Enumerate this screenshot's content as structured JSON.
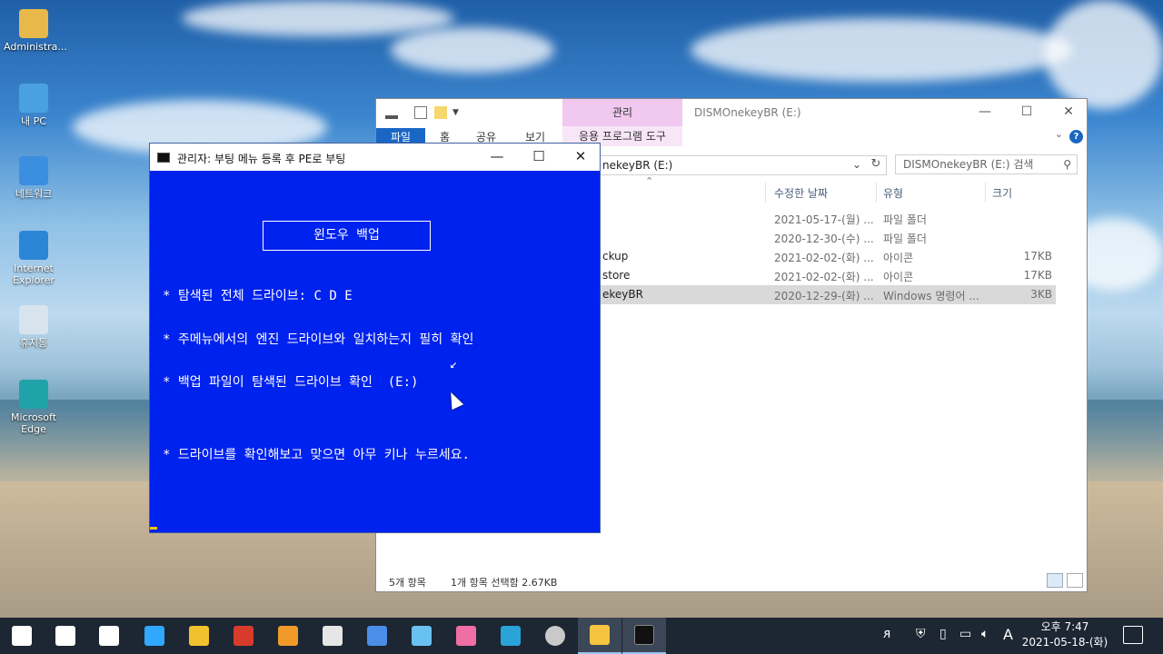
{
  "desktop": {
    "icons": [
      {
        "label": "Administra...",
        "color": "#e8b84a"
      },
      {
        "label": "내 PC",
        "color": "#4aa0e0"
      },
      {
        "label": "네트워크",
        "color": "#3c8fe0"
      },
      {
        "label": "Internet Explorer",
        "color": "#2b86d8"
      },
      {
        "label": "휴지통",
        "color": "#d7e4ee"
      },
      {
        "label": "Microsoft Edge",
        "color": "#1fa3a8"
      }
    ]
  },
  "explorer": {
    "manage_tab": "관리",
    "title": "DISMOnekeyBR (E:)",
    "ribbon_tabs": [
      "파일",
      "홈",
      "공유",
      "보기"
    ],
    "app_tools": "응용 프로그램 도구",
    "address": "nekeyBR (E:)",
    "search_placeholder": "DISMOnekeyBR (E:) 검색",
    "columns": {
      "date": "수정한 날짜",
      "type": "유형",
      "size": "크기"
    },
    "rows": [
      {
        "name": "",
        "date": "2021-05-17-(월) ...",
        "type": "파일 폴더",
        "size": ""
      },
      {
        "name": "",
        "date": "2020-12-30-(수) ...",
        "type": "파일 폴더",
        "size": ""
      },
      {
        "name": "ckup",
        "date": "2021-02-02-(화) ...",
        "type": "아이콘",
        "size": "17KB"
      },
      {
        "name": "store",
        "date": "2021-02-02-(화) ...",
        "type": "아이콘",
        "size": "17KB"
      },
      {
        "name": "ekeyBR",
        "date": "2020-12-29-(화) ...",
        "type": "Windows 명령어 ...",
        "size": "3KB"
      }
    ],
    "status_items": "5개 항목",
    "status_selected": "1개 항목 선택함 2.67KB"
  },
  "cmd": {
    "title": "관리자:  부팅 메뉴 등록 후 PE로 부팅",
    "box_label": "윈도우  백업",
    "line1": "* 탐색된 전체 드라이브: C D E",
    "line2": "* 주메뉴에서의 엔진 드라이브와 일치하는지 필히 확인",
    "line3": "* 백업 파일이 탐색된 드라이브 확인  (E:)",
    "line4": "* 드라이브를 확인해보고 맞으면 아무 키나 누르세요."
  },
  "taskbar": {
    "apps": [
      {
        "name": "start",
        "color": "#ffffff"
      },
      {
        "name": "search",
        "color": "#ffffff"
      },
      {
        "name": "task-view",
        "color": "#ffffff"
      },
      {
        "name": "photoshop",
        "color": "#31a8ff"
      },
      {
        "name": "app-yellow",
        "color": "#f2c12e"
      },
      {
        "name": "app-red-green",
        "color": "#d83b2b"
      },
      {
        "name": "app-orange",
        "color": "#f09a2a"
      },
      {
        "name": "app-tool",
        "color": "#e6e6e6"
      },
      {
        "name": "app-blue",
        "color": "#4a8ee8"
      },
      {
        "name": "app-cyan",
        "color": "#69c1f2"
      },
      {
        "name": "app-pink",
        "color": "#ef6fa5"
      },
      {
        "name": "app-teal",
        "color": "#29a3d8"
      },
      {
        "name": "dvd",
        "color": "#c9c9c9"
      },
      {
        "name": "file-explorer",
        "color": "#f5c542"
      },
      {
        "name": "cmd",
        "color": "#111111"
      }
    ],
    "time": "오후 7:47",
    "date": "2021-05-18-(화)",
    "ime": "A"
  }
}
